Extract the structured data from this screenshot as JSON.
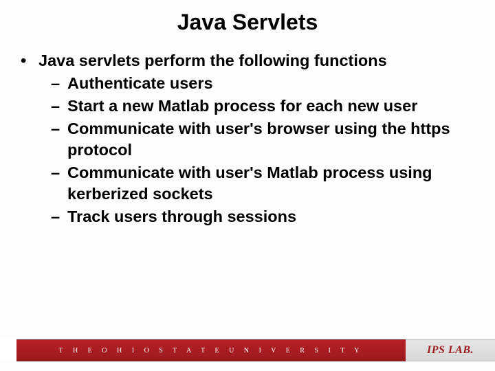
{
  "title": "Java Servlets",
  "content": {
    "intro": "Java servlets perform the following functions",
    "items": [
      "Authenticate users",
      "Start a new Matlab process for each new user",
      "Communicate with user's browser using the https protocol",
      "Communicate with user's Matlab process using kerberized sockets",
      "Track users through sessions"
    ]
  },
  "footer": {
    "university": "T H E   O H I O   S T A T E   U N I V E R S I T Y",
    "lab": "IPS LAB."
  }
}
